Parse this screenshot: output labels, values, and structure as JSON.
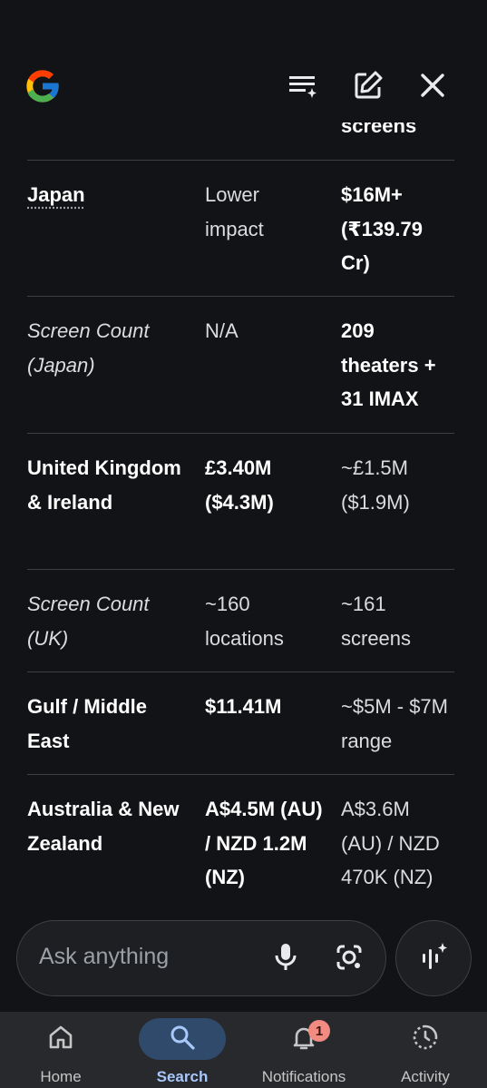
{
  "header": {
    "logo": "google-g-logo",
    "actions": [
      {
        "name": "playlist-add-icon"
      },
      {
        "name": "edit-icon"
      },
      {
        "name": "close-icon"
      }
    ]
  },
  "table": {
    "rows": [
      {
        "c1": "",
        "c2": "",
        "c3": "screens"
      },
      {
        "c1": "Japan",
        "c2": "Lower impact",
        "c3": "$16M+ (₹139.79 Cr)"
      },
      {
        "c1": "Screen Count (Japan)",
        "c2": "N/A",
        "c3": "209 theaters + 31 IMAX"
      },
      {
        "c1": "United Kingdom & Ireland",
        "c2": "£3.40M ($4.3M)",
        "c3": "~£1.5M ($1.9M)"
      },
      {
        "c1": "Screen Count (UK)",
        "c2": "~160 locations",
        "c3": "~161 screens"
      },
      {
        "c1": "Gulf / Middle East",
        "c2": "$11.41M",
        "c3": "~$5M - $7M range"
      },
      {
        "c1": "Australia & New Zealand",
        "c2": "A$4.5M (AU) / NZD 1.2M (NZ)",
        "c3": "A$3.6M (AU) / NZD 470K (NZ)"
      }
    ]
  },
  "search": {
    "placeholder": "Ask anything"
  },
  "nav": {
    "items": [
      {
        "label": "Home",
        "icon": "home-icon"
      },
      {
        "label": "Search",
        "icon": "search-icon"
      },
      {
        "label": "Notifications",
        "icon": "bell-icon",
        "badge": "1"
      },
      {
        "label": "Activity",
        "icon": "activity-icon"
      }
    ]
  },
  "colors": {
    "background": "#121317",
    "nav_background": "#28292d",
    "accent": "#a8c7fa",
    "badge": "#f28b82"
  }
}
